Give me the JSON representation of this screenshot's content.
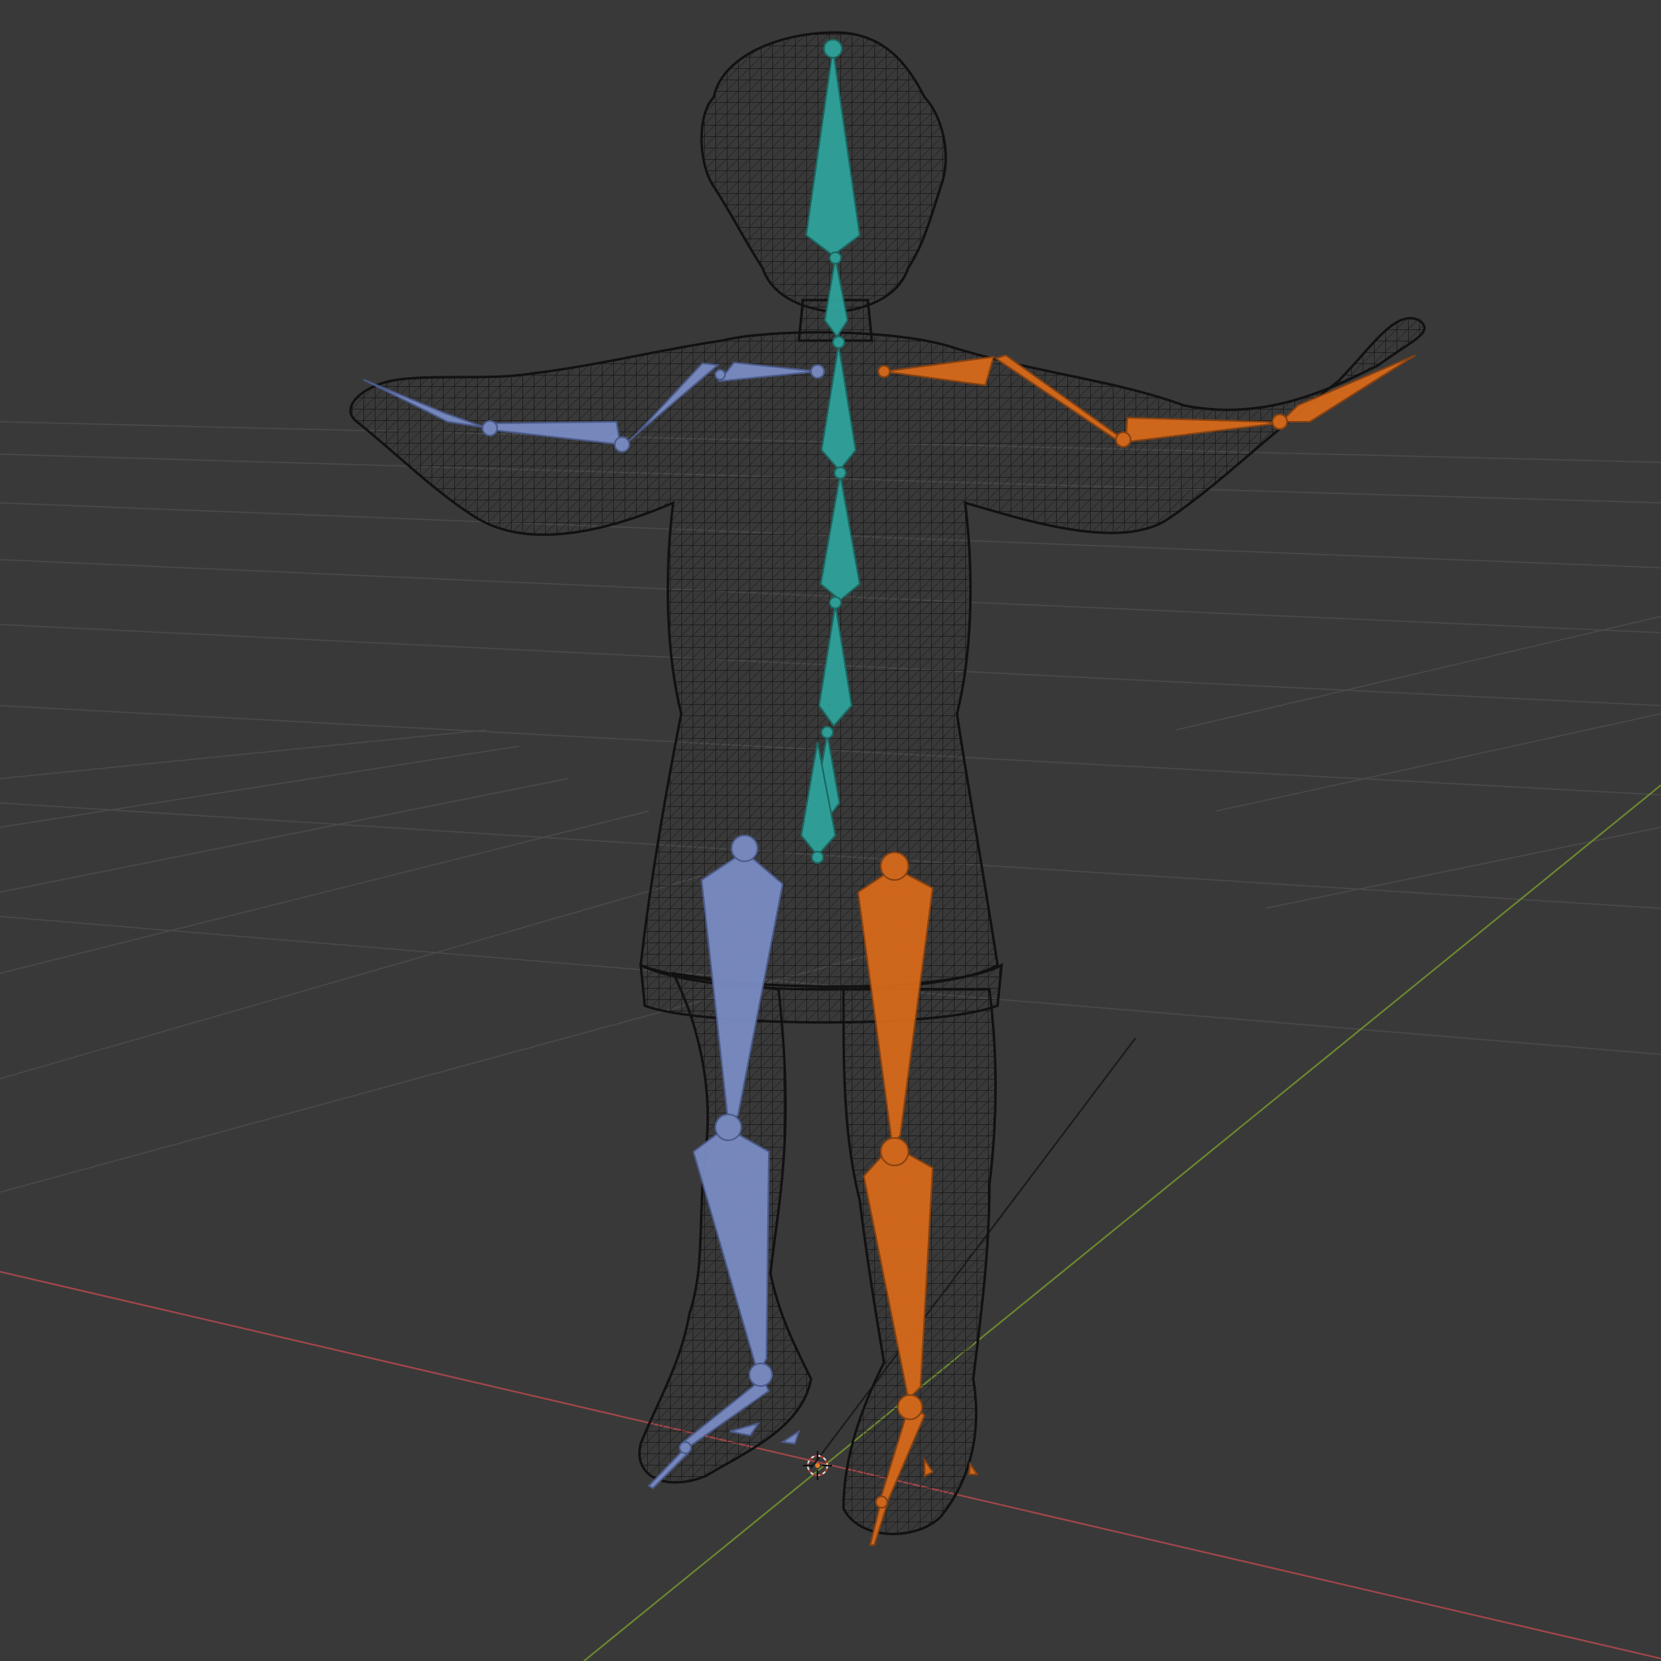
{
  "viewport": {
    "name": "3D Viewport",
    "shading": "wireframe",
    "background_color": "#393939",
    "grid_color": "#474747",
    "axis_x_color": "#a3474b",
    "axis_y_color": "#6d8a2e"
  },
  "scene": {
    "mesh": {
      "name": "character-mesh",
      "wire_color": "#151515"
    },
    "armature": {
      "name": "armature",
      "bone_colors": {
        "spine": "#2fa39b",
        "left": "#7a8cc4",
        "right": "#d66a1b"
      },
      "bones": [
        "head",
        "neck",
        "chest",
        "spine-upper",
        "spine-mid",
        "spine-lower",
        "pelvis",
        "shoulder-l",
        "upper-arm-l",
        "forearm-l",
        "hand-l",
        "shoulder-r",
        "upper-arm-r",
        "forearm-r",
        "hand-r",
        "thigh-l",
        "shin-l",
        "foot-l",
        "toe-l",
        "thigh-r",
        "shin-r",
        "foot-r",
        "toe-r"
      ]
    },
    "origin_icon": "3d-cursor-icon"
  }
}
